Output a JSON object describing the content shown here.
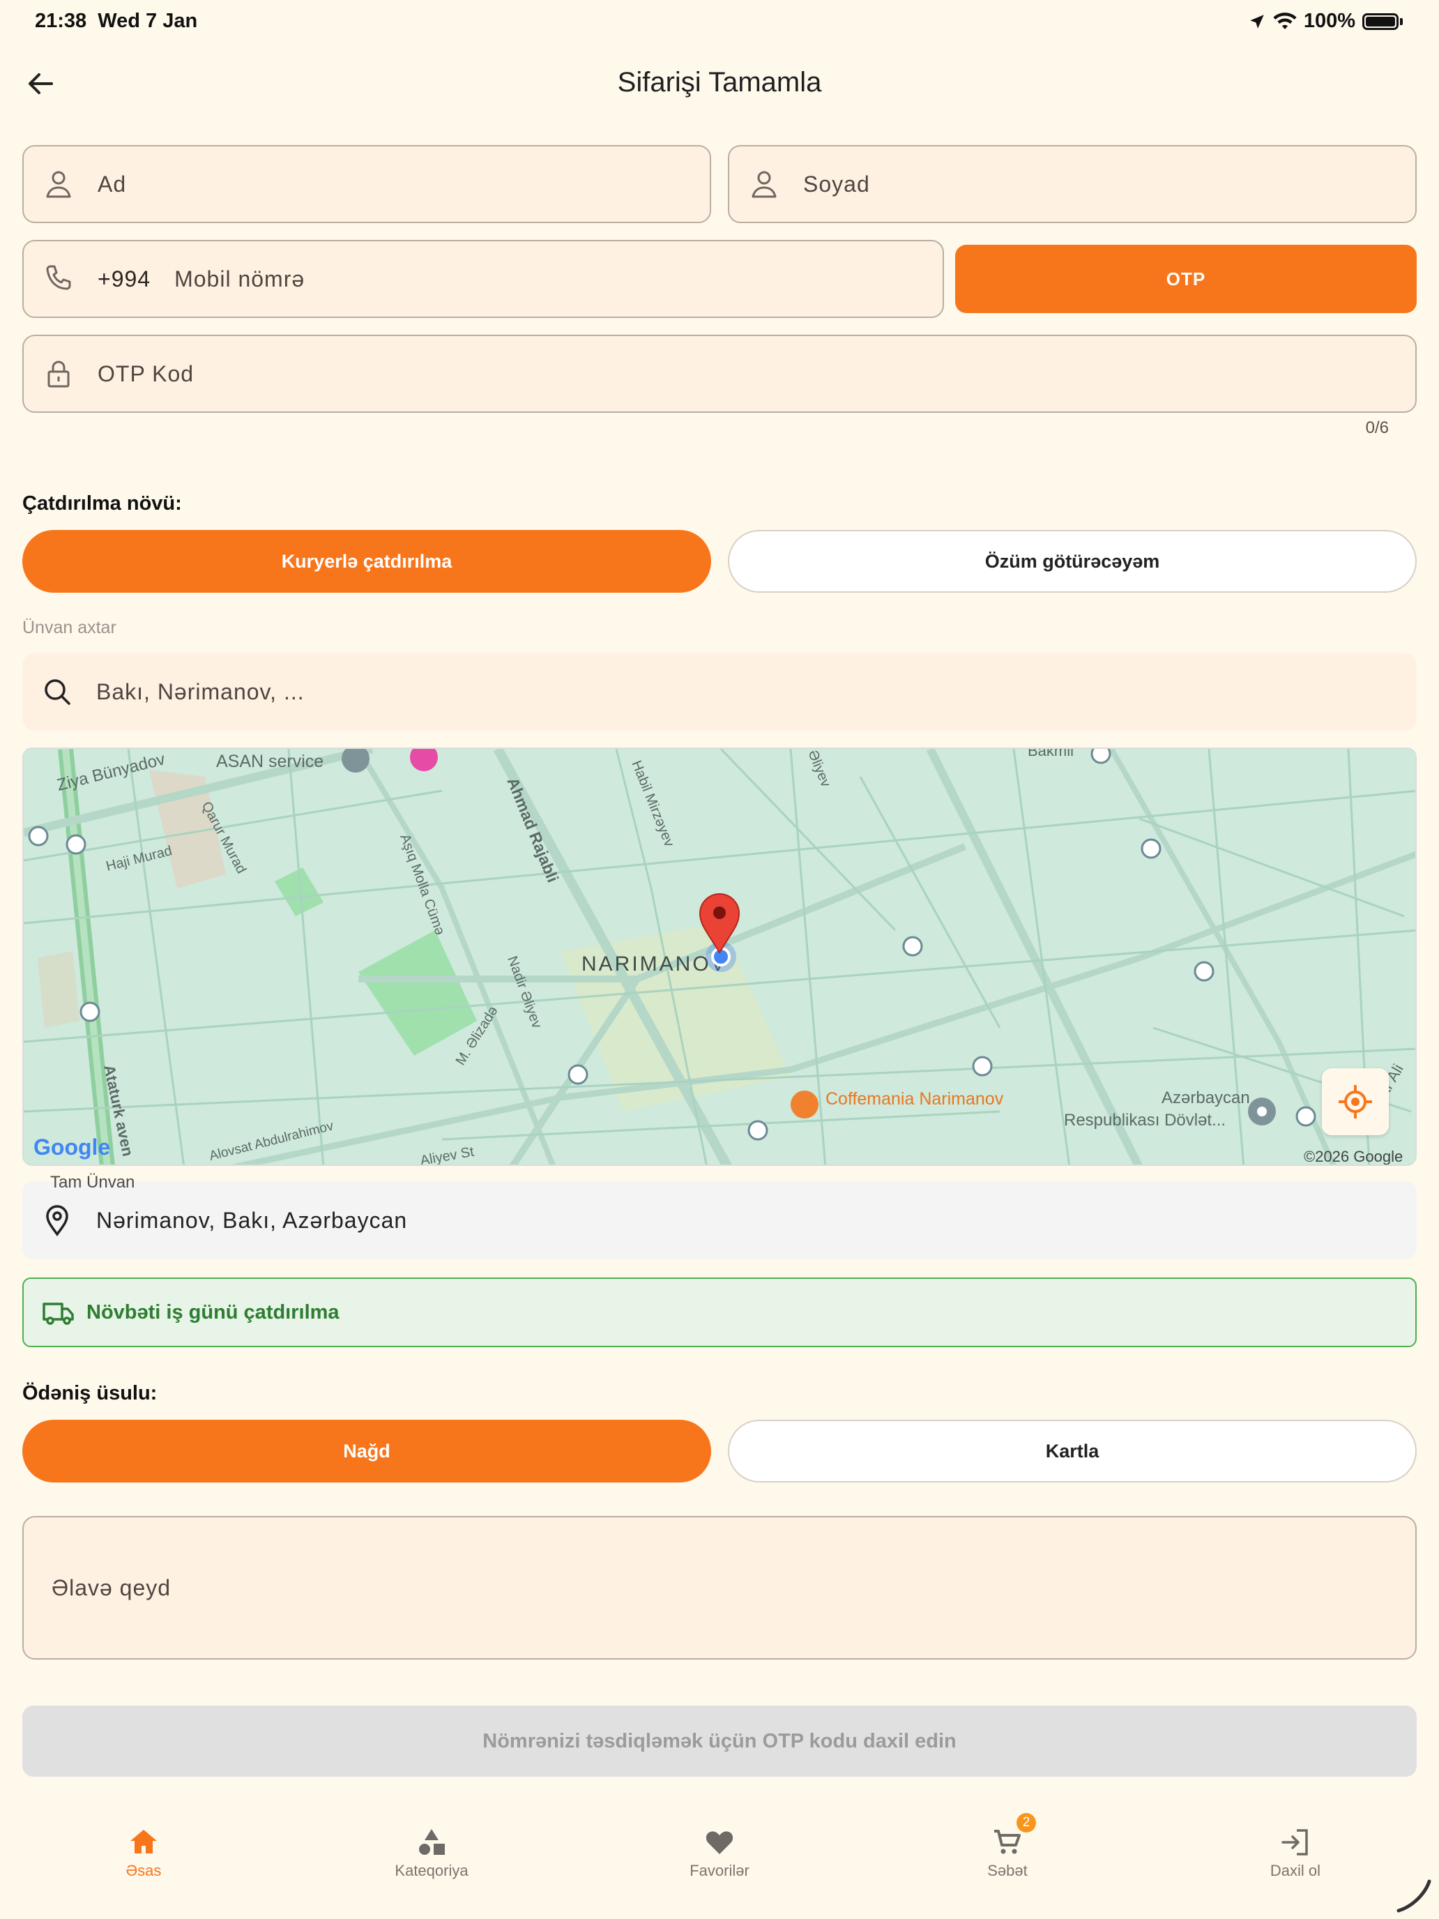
{
  "status_bar": {
    "time": "21:38",
    "date": "Wed 7 Jan",
    "battery": "100%"
  },
  "header": {
    "title": "Sifarişi Tamamla"
  },
  "form": {
    "first_name_placeholder": "Ad",
    "last_name_placeholder": "Soyad",
    "phone_prefix": "+994",
    "phone_placeholder": "Mobil nömrə",
    "otp_button": "OTP",
    "otp_code_placeholder": "OTP Kod",
    "otp_counter": "0/6"
  },
  "delivery": {
    "label": "Çatdırılma növü:",
    "options": [
      "Kuryerlə çatdırılma",
      "Özüm götürəcəyəm"
    ],
    "selected": "Kuryerlə çatdırılma"
  },
  "address_search": {
    "label": "Ünvan axtar",
    "placeholder": "Bakı, Nərimanov, ..."
  },
  "map": {
    "labels": {
      "district": "NARIMANOV",
      "ziya": "Ziya Bünyadov",
      "asan": "ASAN service",
      "qarur": "Qarur Murad",
      "haji": "Haji Murad",
      "ashiq": "Aşıq Molla Cümə",
      "ahmad": "Ahmad Rajabli",
      "habil": "Habil Mirzəyev",
      "aliyev_top": "Əliyev",
      "bakmil": "Bakmil",
      "nadir": "Nadir Əliyev",
      "malizade": "M. Əlizadə",
      "ataturk": "Ataturk aven",
      "alovsat": "Alovsat Abdulrahimov",
      "aliyev_st": "Aliyev St",
      "coffee": "Coffemania Narimanov",
      "azerbaijan1": "Azərbaycan",
      "azerbaijan2": "Respublikası Dövlət...",
      "ali_edge": "ar Ali",
      "google": "Google",
      "copyright": "©2026 Google"
    }
  },
  "full_address": {
    "label": "Tam Ünvan",
    "value": "Nərimanov, Bakı, Azərbaycan"
  },
  "delivery_notice": "Növbəti iş günü çatdırılma",
  "payment": {
    "label": "Ödəniş üsulu:",
    "options": [
      "Nağd",
      "Kartla"
    ],
    "selected": "Nağd"
  },
  "note": {
    "placeholder": "Əlavə qeyd"
  },
  "submit": {
    "label": "Nömrənizi təsdiqləmək üçün OTP kodu daxil edin"
  },
  "tabbar": {
    "items": [
      {
        "label": "Əsas",
        "icon": "home-icon"
      },
      {
        "label": "Kateqoriya",
        "icon": "category-icon"
      },
      {
        "label": "Favorilər",
        "icon": "heart-icon"
      },
      {
        "label": "Səbət",
        "icon": "cart-icon",
        "badge": "2"
      },
      {
        "label": "Daxil ol",
        "icon": "login-icon"
      }
    ],
    "active": "Əsas"
  },
  "colors": {
    "accent": "#f8761b",
    "success": "#2e7d32",
    "background": "#fff9ec"
  }
}
